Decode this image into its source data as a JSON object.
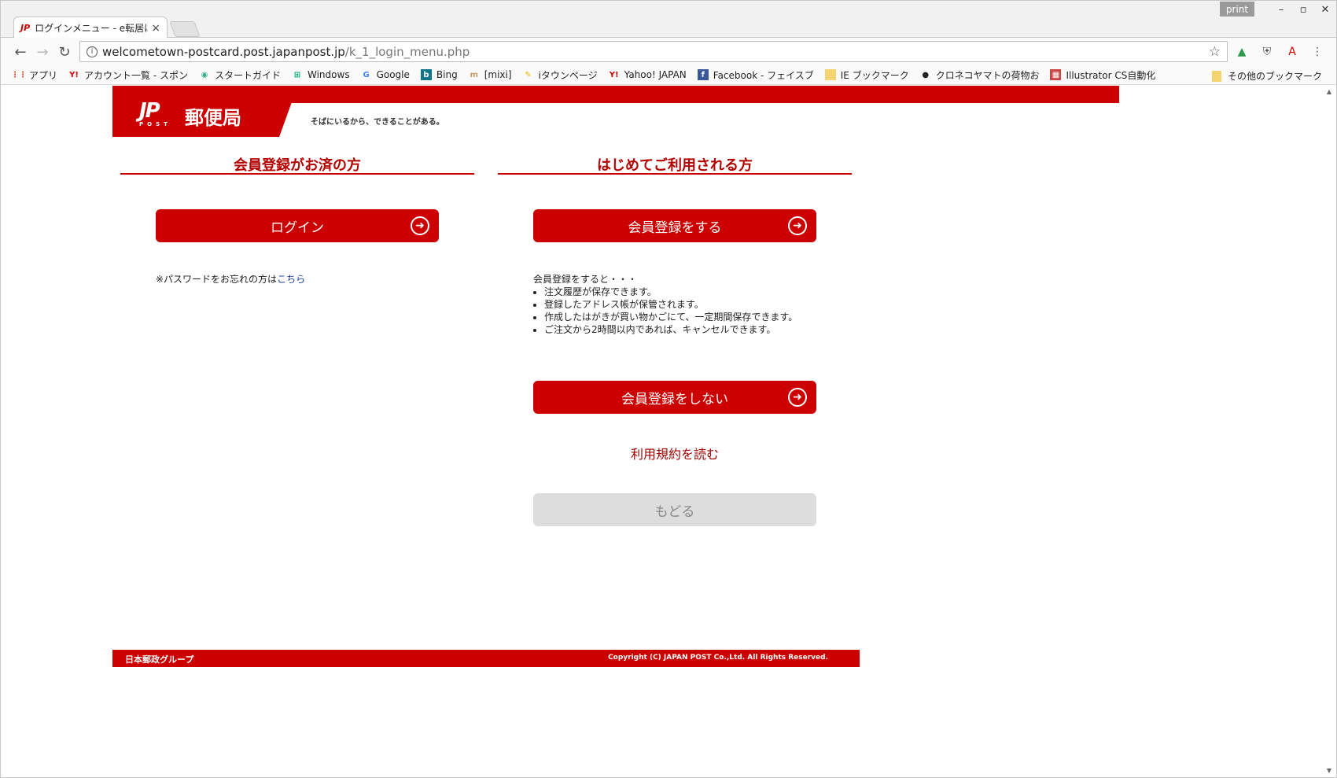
{
  "browser": {
    "tab_title": "ログインメニュー - e転居はが",
    "tab_icon": "JP",
    "tab_close": "×",
    "print_badge": "print",
    "window_controls": [
      "–",
      "▫",
      "✕"
    ],
    "url_host": "welcometown-postcard.post.japanpost.jp",
    "url_path": "/k_1_login_menu.php",
    "bookmarks": [
      {
        "label": "アプリ",
        "icon": "apps-grid-icon"
      },
      {
        "label": "アカウント一覧 - スポン",
        "icon": "yahoo-icon"
      },
      {
        "label": "スタートガイド",
        "icon": "chrome-icon"
      },
      {
        "label": "Windows",
        "icon": "windows-icon"
      },
      {
        "label": "Google",
        "icon": "google-icon"
      },
      {
        "label": "Bing",
        "icon": "bing-icon"
      },
      {
        "label": "[mixi]",
        "icon": "mixi-icon"
      },
      {
        "label": "iタウンページ",
        "icon": "itownpage-icon"
      },
      {
        "label": "Yahoo! JAPAN",
        "icon": "yahoo-icon"
      },
      {
        "label": "Facebook - フェイスブ",
        "icon": "facebook-icon"
      },
      {
        "label": "IE ブックマーク",
        "icon": "folder-icon"
      },
      {
        "label": "クロネコヤマトの荷物お",
        "icon": "kuroneko-icon"
      },
      {
        "label": "Illustrator CS自動化",
        "icon": "illustrator-icon"
      }
    ],
    "bookmarks_more": "»",
    "other_bookmarks": "その他のブックマーク"
  },
  "header": {
    "logo_mark": "JP",
    "logo_post": "POST",
    "logo_name": "郵便局",
    "tagline": "そばにいるから、できることがある。"
  },
  "left": {
    "heading": "会員登録がお済の方",
    "login_button": "ログイン",
    "forgot_text": "※パスワードをお忘れの方は",
    "forgot_link": "こちら"
  },
  "right": {
    "heading": "はじめてご利用される方",
    "register_button": "会員登録をする",
    "benefits_intro": "会員登録をすると・・・",
    "benefits": [
      "注文履歴が保存できます。",
      "登録したアドレス帳が保管されます。",
      "作成したはがきが買い物かごにて、一定期間保存できます。",
      "ご注文から2時間以内であれば、キャンセルできます。"
    ],
    "no_register_button": "会員登録をしない",
    "terms_link": "利用規約を読む",
    "back_button": "もどる"
  },
  "footer": {
    "group_name": "日本郵政グループ",
    "copyright": "Copyright (C) JAPAN POST Co.,Ltd.  All Rights Reserved."
  },
  "colors": {
    "brand_red": "#cc0000",
    "heading_red": "#b30000",
    "link_blue": "#1a3c9c",
    "disabled_gray": "#dddddd"
  }
}
